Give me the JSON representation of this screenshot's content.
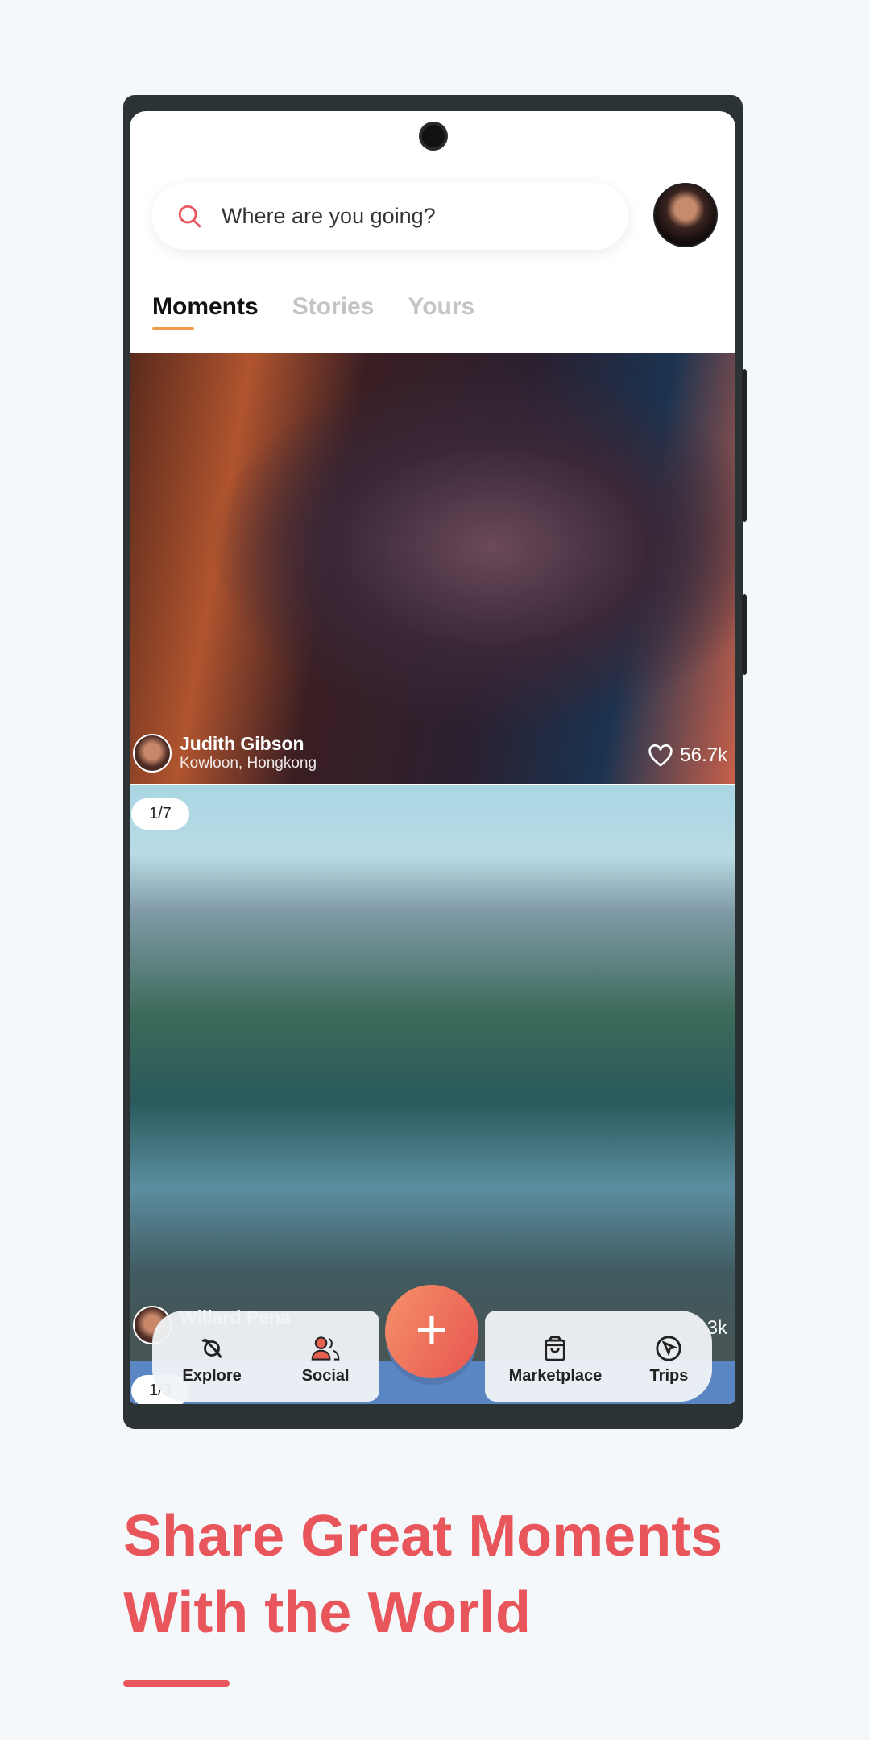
{
  "search": {
    "placeholder": "Where are you going?"
  },
  "tabs": [
    {
      "label": "Moments",
      "active": true
    },
    {
      "label": "Stories"
    },
    {
      "label": "Yours"
    }
  ],
  "posts": [
    {
      "name": "Judith Gibson",
      "location": "Kowloon, Hongkong",
      "likes": "56.7k"
    },
    {
      "name": "Willard Pena",
      "likes": "3k",
      "pager": "1/7"
    },
    {
      "pager": "1/3"
    }
  ],
  "nav": {
    "explore": "Explore",
    "social": "Social",
    "add": "+",
    "marketplace": "Marketplace",
    "trips": "Trips"
  },
  "headline": {
    "line1": "Share Great Moments",
    "line2": "With the World"
  },
  "colors": {
    "accent": "#e8555a",
    "tab_underline": "#f09a4a",
    "background": "#f4f8fb"
  }
}
